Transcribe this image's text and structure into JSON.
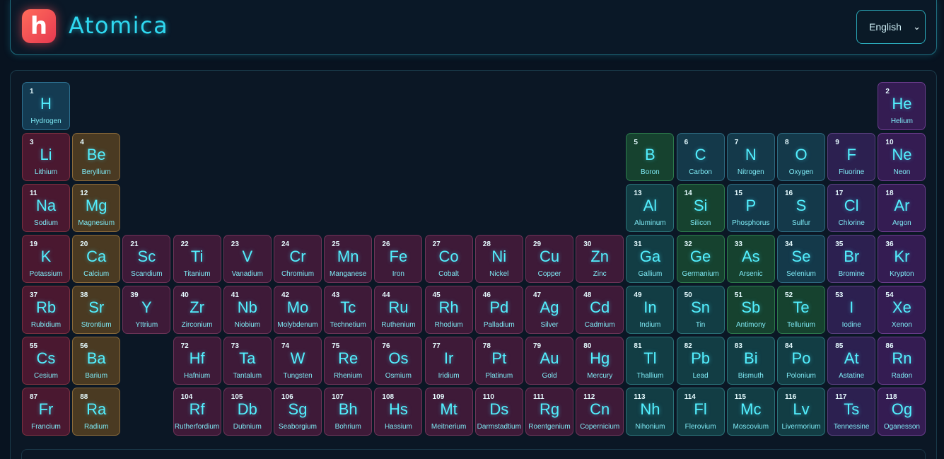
{
  "app": {
    "logo_letter": "h",
    "title": "Atomica"
  },
  "language": {
    "selected": "English"
  },
  "elements": [
    {
      "n": "1",
      "s": "H",
      "name": "Hydrogen",
      "g": 1,
      "p": 1,
      "cat": "hydrogen"
    },
    {
      "n": "2",
      "s": "He",
      "name": "Helium",
      "g": 18,
      "p": 1,
      "cat": "noble"
    },
    {
      "n": "3",
      "s": "Li",
      "name": "Lithium",
      "g": 1,
      "p": 2,
      "cat": "alkali"
    },
    {
      "n": "4",
      "s": "Be",
      "name": "Beryllium",
      "g": 2,
      "p": 2,
      "cat": "alkaline"
    },
    {
      "n": "5",
      "s": "B",
      "name": "Boron",
      "g": 13,
      "p": 2,
      "cat": "metalloid"
    },
    {
      "n": "6",
      "s": "C",
      "name": "Carbon",
      "g": 14,
      "p": 2,
      "cat": "nonmetal"
    },
    {
      "n": "7",
      "s": "N",
      "name": "Nitrogen",
      "g": 15,
      "p": 2,
      "cat": "nonmetal"
    },
    {
      "n": "8",
      "s": "O",
      "name": "Oxygen",
      "g": 16,
      "p": 2,
      "cat": "nonmetal"
    },
    {
      "n": "9",
      "s": "F",
      "name": "Fluorine",
      "g": 17,
      "p": 2,
      "cat": "halogen"
    },
    {
      "n": "10",
      "s": "Ne",
      "name": "Neon",
      "g": 18,
      "p": 2,
      "cat": "noble"
    },
    {
      "n": "11",
      "s": "Na",
      "name": "Sodium",
      "g": 1,
      "p": 3,
      "cat": "alkali"
    },
    {
      "n": "12",
      "s": "Mg",
      "name": "Magnesium",
      "g": 2,
      "p": 3,
      "cat": "alkaline"
    },
    {
      "n": "13",
      "s": "Al",
      "name": "Aluminum",
      "g": 13,
      "p": 3,
      "cat": "post"
    },
    {
      "n": "14",
      "s": "Si",
      "name": "Silicon",
      "g": 14,
      "p": 3,
      "cat": "metalloid"
    },
    {
      "n": "15",
      "s": "P",
      "name": "Phosphorus",
      "g": 15,
      "p": 3,
      "cat": "nonmetal"
    },
    {
      "n": "16",
      "s": "S",
      "name": "Sulfur",
      "g": 16,
      "p": 3,
      "cat": "nonmetal"
    },
    {
      "n": "17",
      "s": "Cl",
      "name": "Chlorine",
      "g": 17,
      "p": 3,
      "cat": "halogen"
    },
    {
      "n": "18",
      "s": "Ar",
      "name": "Argon",
      "g": 18,
      "p": 3,
      "cat": "noble"
    },
    {
      "n": "19",
      "s": "K",
      "name": "Potassium",
      "g": 1,
      "p": 4,
      "cat": "alkali"
    },
    {
      "n": "20",
      "s": "Ca",
      "name": "Calcium",
      "g": 2,
      "p": 4,
      "cat": "alkaline"
    },
    {
      "n": "21",
      "s": "Sc",
      "name": "Scandium",
      "g": 3,
      "p": 4,
      "cat": "transition"
    },
    {
      "n": "22",
      "s": "Ti",
      "name": "Titanium",
      "g": 4,
      "p": 4,
      "cat": "transition"
    },
    {
      "n": "23",
      "s": "V",
      "name": "Vanadium",
      "g": 5,
      "p": 4,
      "cat": "transition"
    },
    {
      "n": "24",
      "s": "Cr",
      "name": "Chromium",
      "g": 6,
      "p": 4,
      "cat": "transition"
    },
    {
      "n": "25",
      "s": "Mn",
      "name": "Manganese",
      "g": 7,
      "p": 4,
      "cat": "transition"
    },
    {
      "n": "26",
      "s": "Fe",
      "name": "Iron",
      "g": 8,
      "p": 4,
      "cat": "transition"
    },
    {
      "n": "27",
      "s": "Co",
      "name": "Cobalt",
      "g": 9,
      "p": 4,
      "cat": "transition"
    },
    {
      "n": "28",
      "s": "Ni",
      "name": "Nickel",
      "g": 10,
      "p": 4,
      "cat": "transition"
    },
    {
      "n": "29",
      "s": "Cu",
      "name": "Copper",
      "g": 11,
      "p": 4,
      "cat": "transition"
    },
    {
      "n": "30",
      "s": "Zn",
      "name": "Zinc",
      "g": 12,
      "p": 4,
      "cat": "transition"
    },
    {
      "n": "31",
      "s": "Ga",
      "name": "Gallium",
      "g": 13,
      "p": 4,
      "cat": "post"
    },
    {
      "n": "32",
      "s": "Ge",
      "name": "Germanium",
      "g": 14,
      "p": 4,
      "cat": "metalloid"
    },
    {
      "n": "33",
      "s": "As",
      "name": "Arsenic",
      "g": 15,
      "p": 4,
      "cat": "metalloid"
    },
    {
      "n": "34",
      "s": "Se",
      "name": "Selenium",
      "g": 16,
      "p": 4,
      "cat": "nonmetal"
    },
    {
      "n": "35",
      "s": "Br",
      "name": "Bromine",
      "g": 17,
      "p": 4,
      "cat": "halogen"
    },
    {
      "n": "36",
      "s": "Kr",
      "name": "Krypton",
      "g": 18,
      "p": 4,
      "cat": "noble"
    },
    {
      "n": "37",
      "s": "Rb",
      "name": "Rubidium",
      "g": 1,
      "p": 5,
      "cat": "alkali"
    },
    {
      "n": "38",
      "s": "Sr",
      "name": "Strontium",
      "g": 2,
      "p": 5,
      "cat": "alkaline"
    },
    {
      "n": "39",
      "s": "Y",
      "name": "Yttrium",
      "g": 3,
      "p": 5,
      "cat": "transition"
    },
    {
      "n": "40",
      "s": "Zr",
      "name": "Zirconium",
      "g": 4,
      "p": 5,
      "cat": "transition"
    },
    {
      "n": "41",
      "s": "Nb",
      "name": "Niobium",
      "g": 5,
      "p": 5,
      "cat": "transition"
    },
    {
      "n": "42",
      "s": "Mo",
      "name": "Molybdenum",
      "g": 6,
      "p": 5,
      "cat": "transition"
    },
    {
      "n": "43",
      "s": "Tc",
      "name": "Technetium",
      "g": 7,
      "p": 5,
      "cat": "transition"
    },
    {
      "n": "44",
      "s": "Ru",
      "name": "Ruthenium",
      "g": 8,
      "p": 5,
      "cat": "transition"
    },
    {
      "n": "45",
      "s": "Rh",
      "name": "Rhodium",
      "g": 9,
      "p": 5,
      "cat": "transition"
    },
    {
      "n": "46",
      "s": "Pd",
      "name": "Palladium",
      "g": 10,
      "p": 5,
      "cat": "transition"
    },
    {
      "n": "47",
      "s": "Ag",
      "name": "Silver",
      "g": 11,
      "p": 5,
      "cat": "transition"
    },
    {
      "n": "48",
      "s": "Cd",
      "name": "Cadmium",
      "g": 12,
      "p": 5,
      "cat": "transition"
    },
    {
      "n": "49",
      "s": "In",
      "name": "Indium",
      "g": 13,
      "p": 5,
      "cat": "post"
    },
    {
      "n": "50",
      "s": "Sn",
      "name": "Tin",
      "g": 14,
      "p": 5,
      "cat": "post"
    },
    {
      "n": "51",
      "s": "Sb",
      "name": "Antimony",
      "g": 15,
      "p": 5,
      "cat": "metalloid"
    },
    {
      "n": "52",
      "s": "Te",
      "name": "Tellurium",
      "g": 16,
      "p": 5,
      "cat": "metalloid"
    },
    {
      "n": "53",
      "s": "I",
      "name": "Iodine",
      "g": 17,
      "p": 5,
      "cat": "halogen"
    },
    {
      "n": "54",
      "s": "Xe",
      "name": "Xenon",
      "g": 18,
      "p": 5,
      "cat": "noble"
    },
    {
      "n": "55",
      "s": "Cs",
      "name": "Cesium",
      "g": 1,
      "p": 6,
      "cat": "alkali"
    },
    {
      "n": "56",
      "s": "Ba",
      "name": "Barium",
      "g": 2,
      "p": 6,
      "cat": "alkaline"
    },
    {
      "n": "72",
      "s": "Hf",
      "name": "Hafnium",
      "g": 4,
      "p": 6,
      "cat": "transition"
    },
    {
      "n": "73",
      "s": "Ta",
      "name": "Tantalum",
      "g": 5,
      "p": 6,
      "cat": "transition"
    },
    {
      "n": "74",
      "s": "W",
      "name": "Tungsten",
      "g": 6,
      "p": 6,
      "cat": "transition"
    },
    {
      "n": "75",
      "s": "Re",
      "name": "Rhenium",
      "g": 7,
      "p": 6,
      "cat": "transition"
    },
    {
      "n": "76",
      "s": "Os",
      "name": "Osmium",
      "g": 8,
      "p": 6,
      "cat": "transition"
    },
    {
      "n": "77",
      "s": "Ir",
      "name": "Iridium",
      "g": 9,
      "p": 6,
      "cat": "transition"
    },
    {
      "n": "78",
      "s": "Pt",
      "name": "Platinum",
      "g": 10,
      "p": 6,
      "cat": "transition"
    },
    {
      "n": "79",
      "s": "Au",
      "name": "Gold",
      "g": 11,
      "p": 6,
      "cat": "transition"
    },
    {
      "n": "80",
      "s": "Hg",
      "name": "Mercury",
      "g": 12,
      "p": 6,
      "cat": "transition"
    },
    {
      "n": "81",
      "s": "Tl",
      "name": "Thallium",
      "g": 13,
      "p": 6,
      "cat": "post"
    },
    {
      "n": "82",
      "s": "Pb",
      "name": "Lead",
      "g": 14,
      "p": 6,
      "cat": "post"
    },
    {
      "n": "83",
      "s": "Bi",
      "name": "Bismuth",
      "g": 15,
      "p": 6,
      "cat": "post"
    },
    {
      "n": "84",
      "s": "Po",
      "name": "Polonium",
      "g": 16,
      "p": 6,
      "cat": "post"
    },
    {
      "n": "85",
      "s": "At",
      "name": "Astatine",
      "g": 17,
      "p": 6,
      "cat": "halogen"
    },
    {
      "n": "86",
      "s": "Rn",
      "name": "Radon",
      "g": 18,
      "p": 6,
      "cat": "noble"
    },
    {
      "n": "87",
      "s": "Fr",
      "name": "Francium",
      "g": 1,
      "p": 7,
      "cat": "alkali"
    },
    {
      "n": "88",
      "s": "Ra",
      "name": "Radium",
      "g": 2,
      "p": 7,
      "cat": "alkaline"
    },
    {
      "n": "104",
      "s": "Rf",
      "name": "Rutherfordium",
      "g": 4,
      "p": 7,
      "cat": "transition"
    },
    {
      "n": "105",
      "s": "Db",
      "name": "Dubnium",
      "g": 5,
      "p": 7,
      "cat": "transition"
    },
    {
      "n": "106",
      "s": "Sg",
      "name": "Seaborgium",
      "g": 6,
      "p": 7,
      "cat": "transition"
    },
    {
      "n": "107",
      "s": "Bh",
      "name": "Bohrium",
      "g": 7,
      "p": 7,
      "cat": "transition"
    },
    {
      "n": "108",
      "s": "Hs",
      "name": "Hassium",
      "g": 8,
      "p": 7,
      "cat": "transition"
    },
    {
      "n": "109",
      "s": "Mt",
      "name": "Meitnerium",
      "g": 9,
      "p": 7,
      "cat": "transition"
    },
    {
      "n": "110",
      "s": "Ds",
      "name": "Darmstadtium",
      "g": 10,
      "p": 7,
      "cat": "transition"
    },
    {
      "n": "111",
      "s": "Rg",
      "name": "Roentgenium",
      "g": 11,
      "p": 7,
      "cat": "transition"
    },
    {
      "n": "112",
      "s": "Cn",
      "name": "Copernicium",
      "g": 12,
      "p": 7,
      "cat": "transition"
    },
    {
      "n": "113",
      "s": "Nh",
      "name": "Nihonium",
      "g": 13,
      "p": 7,
      "cat": "post"
    },
    {
      "n": "114",
      "s": "Fl",
      "name": "Flerovium",
      "g": 14,
      "p": 7,
      "cat": "post"
    },
    {
      "n": "115",
      "s": "Mc",
      "name": "Moscovium",
      "g": 15,
      "p": 7,
      "cat": "post"
    },
    {
      "n": "116",
      "s": "Lv",
      "name": "Livermorium",
      "g": 16,
      "p": 7,
      "cat": "post"
    },
    {
      "n": "117",
      "s": "Ts",
      "name": "Tennessine",
      "g": 17,
      "p": 7,
      "cat": "halogen"
    },
    {
      "n": "118",
      "s": "Og",
      "name": "Oganesson",
      "g": 18,
      "p": 7,
      "cat": "noble"
    }
  ]
}
